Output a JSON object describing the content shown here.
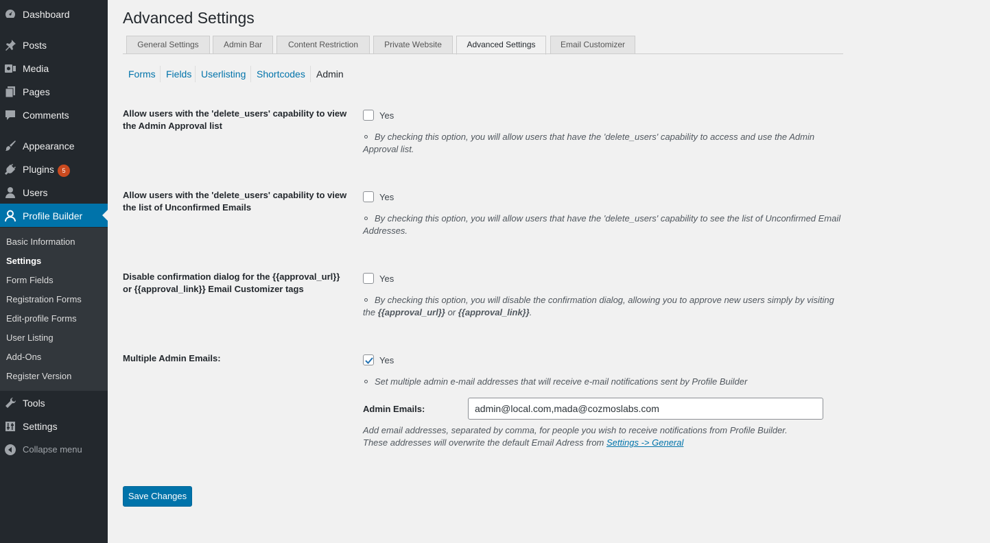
{
  "sidebar": {
    "items": [
      {
        "label": "Dashboard",
        "icon": "dashboard-icon"
      },
      {
        "label": "Posts",
        "icon": "pin-icon"
      },
      {
        "label": "Media",
        "icon": "media-icon"
      },
      {
        "label": "Pages",
        "icon": "pages-icon"
      },
      {
        "label": "Comments",
        "icon": "comment-icon"
      },
      {
        "label": "Appearance",
        "icon": "brush-icon"
      },
      {
        "label": "Plugins",
        "icon": "plugin-icon",
        "badge": "5"
      },
      {
        "label": "Users",
        "icon": "user-icon"
      },
      {
        "label": "Profile Builder",
        "icon": "person-outline-icon",
        "active": true
      },
      {
        "label": "Tools",
        "icon": "wrench-icon"
      },
      {
        "label": "Settings",
        "icon": "sliders-icon"
      }
    ],
    "submenu": [
      "Basic Information",
      "Settings",
      "Form Fields",
      "Registration Forms",
      "Edit-profile Forms",
      "User Listing",
      "Add-Ons",
      "Register Version"
    ],
    "submenu_current": "Settings",
    "collapse_label": "Collapse menu"
  },
  "page": {
    "title": "Advanced Settings"
  },
  "tabs": [
    "General Settings",
    "Admin Bar",
    "Content Restriction",
    "Private Website",
    "Advanced Settings",
    "Email Customizer"
  ],
  "active_tab": "Advanced Settings",
  "subsubsub": [
    "Forms",
    "Fields",
    "Userlisting",
    "Shortcodes",
    "Admin"
  ],
  "subsubsub_current": "Admin",
  "options": [
    {
      "label": "Allow users with the 'delete_users' capability to view the Admin Approval list",
      "checkbox_label": "Yes",
      "checked": false,
      "description": "By checking this option, you will allow users that have the 'delete_users' capability to access and use the Admin Approval list."
    },
    {
      "label": "Allow users with the 'delete_users' capability to view the list of Unconfirmed Emails",
      "checkbox_label": "Yes",
      "checked": false,
      "description": "By checking this option, you will allow users that have the 'delete_users' capability to see the list of Unconfirmed Email Addresses."
    },
    {
      "label": "Disable confirmation dialog for the {{approval_url}} or {{approval_link}} Email Customizer tags",
      "checkbox_label": "Yes",
      "checked": false,
      "description_before": "By checking this option, you will disable the confirmation dialog, allowing you to approve new users simply by visiting the ",
      "description_tag1": "{{approval_url}}",
      "description_mid": " or ",
      "description_tag2": "{{approval_link}}",
      "description_after": "."
    },
    {
      "label": "Multiple Admin Emails:",
      "checkbox_label": "Yes",
      "checked": true,
      "description": "Set multiple admin e-mail addresses that will receive e-mail notifications sent by Profile Builder"
    }
  ],
  "admin_emails": {
    "label": "Admin Emails:",
    "value": "admin@local.com,mada@cozmoslabs.com",
    "help_line1": "Add email addresses, separated by comma, for people you wish to receive notifications from Profile Builder.",
    "help_line2_before": "These addresses will overwrite the default Email Adress from ",
    "help_link": "Settings -> General"
  },
  "save_label": "Save Changes",
  "colors": {
    "sidebar_bg": "#23282d",
    "submenu_bg": "#32373c",
    "accent": "#0073aa",
    "badge": "#ca4a1f"
  }
}
